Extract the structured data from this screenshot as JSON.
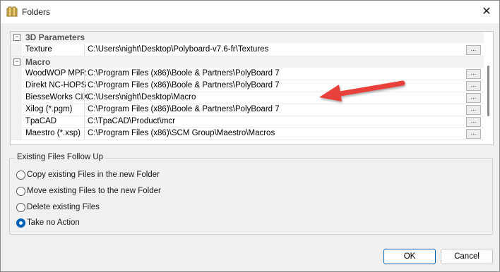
{
  "window": {
    "title": "Folders",
    "close_glyph": "✕",
    "icon": "folders-app-icon"
  },
  "grid": {
    "ellipsis_label": "...",
    "categories": [
      {
        "label": "3D Parameters",
        "toggle": "−",
        "rows": [
          {
            "name": "Texture",
            "value": "C:\\Users\\night\\Desktop\\Polyboard-v7.6-fr\\Textures"
          }
        ]
      },
      {
        "label": "Macro",
        "toggle": "−",
        "rows": [
          {
            "name": "WoodWOP MPR",
            "value": "C:\\Program Files (x86)\\Boole & Partners\\PolyBoard 7"
          },
          {
            "name": "Direkt NC-HOPS",
            "value": "C:\\Program Files (x86)\\Boole & Partners\\PolyBoard 7"
          },
          {
            "name": "BiesseWorks CIX",
            "value": "C:\\Users\\night\\Desktop\\Macro"
          },
          {
            "name": "Xilog (*.pgm)",
            "value": "C:\\Program Files (x86)\\Boole & Partners\\PolyBoard 7"
          },
          {
            "name": "TpaCAD",
            "value": "C:\\TpaCAD\\Product\\mcr"
          },
          {
            "name": "Maestro (*.xsp)",
            "value": "C:\\Program Files (x86)\\SCM Group\\Maestro\\Macros"
          }
        ]
      }
    ]
  },
  "annotation": {
    "arrow_color": "#e8413a",
    "icon": "red-arrow-annotation"
  },
  "follow_up": {
    "title": "Existing Files Follow Up",
    "options": [
      {
        "label": "Copy existing Files in the new Folder",
        "checked": false
      },
      {
        "label": "Move existing Files to the new Folder",
        "checked": false
      },
      {
        "label": "Delete existing Files",
        "checked": false
      },
      {
        "label": "Take no Action",
        "checked": true
      }
    ]
  },
  "buttons": {
    "ok": "OK",
    "cancel": "Cancel"
  },
  "colors": {
    "accent": "#005fb8",
    "window_bg": "#f0f0f0"
  }
}
